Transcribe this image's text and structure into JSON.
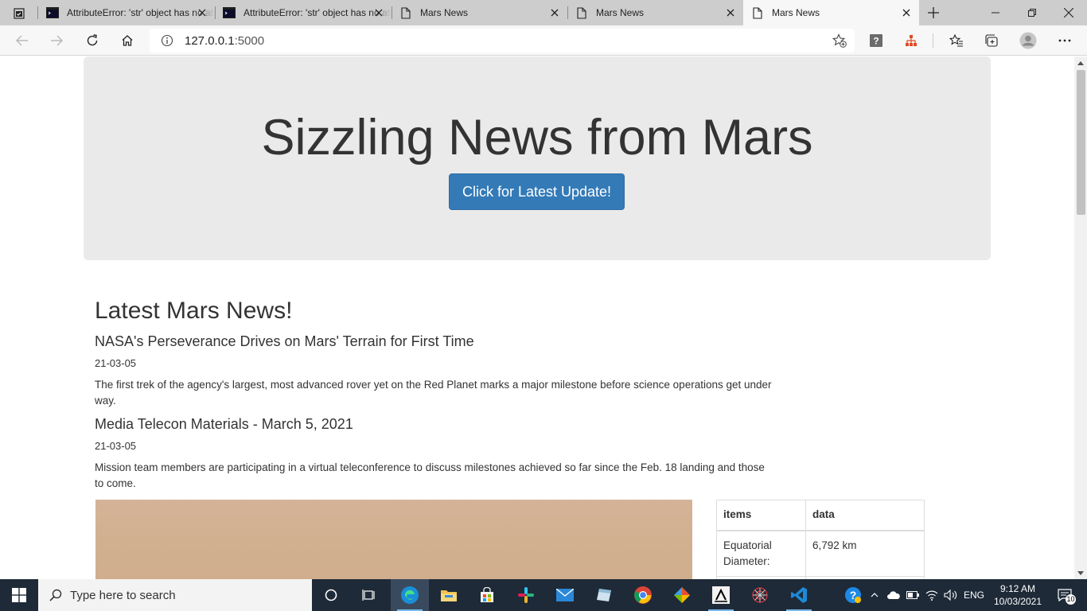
{
  "browser": {
    "tabs": [
      {
        "title": "AttributeError: 'str' object has no attribute",
        "favicon": "terminal-icon",
        "active": false
      },
      {
        "title": "AttributeError: 'str' object has no attribute",
        "favicon": "terminal-icon",
        "active": false
      },
      {
        "title": "Mars News",
        "favicon": "page-icon",
        "active": false
      },
      {
        "title": "Mars News",
        "favicon": "page-icon",
        "active": false
      },
      {
        "title": "Mars News",
        "favicon": "page-icon",
        "active": true
      }
    ],
    "address": {
      "host": "127.0.0.1",
      "port": ":5000"
    }
  },
  "page": {
    "jumbotron": {
      "title": "Sizzling News from Mars",
      "button_label": "Click for Latest Update!",
      "background": "#eaeaea",
      "button_color": "#337ab7"
    },
    "news_heading": "Latest Mars News!",
    "articles": [
      {
        "title": "NASA's Perseverance Drives on Mars' Terrain for First Time",
        "date": "21-03-05",
        "teaser": "The first trek of the agency's largest, most advanced rover yet on the Red Planet marks a major milestone before science operations get under way."
      },
      {
        "title": "Media Telecon Materials - March 5, 2021",
        "date": "21-03-05",
        "teaser": "Mission team members are participating in a virtual teleconference to discuss milestones achieved so far since the Feb. 18 landing and those to come."
      }
    ],
    "facts_table": {
      "headers": [
        "items",
        "data"
      ],
      "rows": [
        [
          "Equatorial Diameter:",
          "6,792 km"
        ],
        [
          "",
          ""
        ]
      ]
    }
  },
  "taskbar": {
    "search_placeholder": "Type here to search",
    "language": "ENG",
    "time": "9:12 AM",
    "date": "10/03/2021",
    "notifications": "10"
  }
}
